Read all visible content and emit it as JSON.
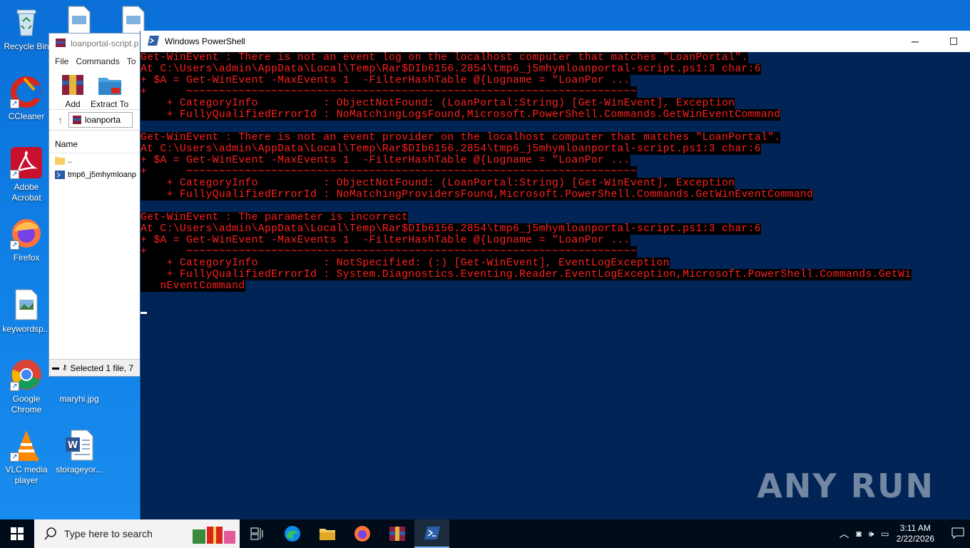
{
  "desktop": {
    "icons": [
      {
        "label": "Recycle Bin"
      },
      {
        "label": "CCleaner"
      },
      {
        "label": "Adobe Acrobat"
      },
      {
        "label": "Firefox"
      },
      {
        "label": "keywordsp..."
      },
      {
        "label": "Google Chrome"
      },
      {
        "label": "VLC media player"
      },
      {
        "label": "maryhi.jpg"
      },
      {
        "label": "storageyor..."
      }
    ]
  },
  "winrar": {
    "title": "loanportal-script.p",
    "menu": [
      "File",
      "Commands",
      "To"
    ],
    "tools": [
      {
        "label": "Add"
      },
      {
        "label": "Extract To"
      }
    ],
    "address": "loanporta",
    "column_name": "Name",
    "rows": [
      "..",
      "tmp6_j5mhymloanp"
    ],
    "status": "Selected 1 file, 7"
  },
  "powershell": {
    "title": "Windows PowerShell",
    "lines": [
      "Get-WinEvent : There is not an event log on the localhost computer that matches \"LoanPortal\".",
      "At C:\\Users\\admin\\AppData\\Local\\Temp\\Rar$DIb6156.2854\\tmp6_j5mhymloanportal-script.ps1:3 char:6",
      "+ $A = Get-WinEvent -MaxEvents 1  -FilterHashTable @{Logname = \"LoanPor ...",
      "+      ~~~~~~~~~~~~~~~~~~~~~~~~~~~~~~~~~~~~~~~~~~~~~~~~~~~~~~~~~~~~~~~~~~~~~",
      "    + CategoryInfo          : ObjectNotFound: (LoanPortal:String) [Get-WinEvent], Exception",
      "    + FullyQualifiedErrorId : NoMatchingLogsFound,Microsoft.PowerShell.Commands.GetWinEventCommand",
      "",
      "Get-WinEvent : There is not an event provider on the localhost computer that matches \"LoanPortal\".",
      "At C:\\Users\\admin\\AppData\\Local\\Temp\\Rar$DIb6156.2854\\tmp6_j5mhymloanportal-script.ps1:3 char:6",
      "+ $A = Get-WinEvent -MaxEvents 1  -FilterHashTable @{Logname = \"LoanPor ...",
      "+      ~~~~~~~~~~~~~~~~~~~~~~~~~~~~~~~~~~~~~~~~~~~~~~~~~~~~~~~~~~~~~~~~~~~~~",
      "    + CategoryInfo          : ObjectNotFound: (LoanPortal:String) [Get-WinEvent], Exception",
      "    + FullyQualifiedErrorId : NoMatchingProvidersFound,Microsoft.PowerShell.Commands.GetWinEventCommand",
      "",
      "Get-WinEvent : The parameter is incorrect",
      "At C:\\Users\\admin\\AppData\\Local\\Temp\\Rar$DIb6156.2854\\tmp6_j5mhymloanportal-script.ps1:3 char:6",
      "+ $A = Get-WinEvent -MaxEvents 1  -FilterHashTable @{Logname = \"LoanPor ...",
      "+      ~~~~~~~~~~~~~~~~~~~~~~~~~~~~~~~~~~~~~~~~~~~~~~~~~~~~~~~~~~~~~~~~~~~~~",
      "    + CategoryInfo          : NotSpecified: (:) [Get-WinEvent], EventLogException",
      "    + FullyQualifiedErrorId : System.Diagnostics.Eventing.Reader.EventLogException,Microsoft.PowerShell.Commands.GetWi",
      "   nEventCommand",
      ""
    ]
  },
  "watermark": "ANY RUN",
  "taskbar": {
    "search_placeholder": "Type here to search",
    "time": "3:11 AM",
    "date": "2/22/2026"
  }
}
